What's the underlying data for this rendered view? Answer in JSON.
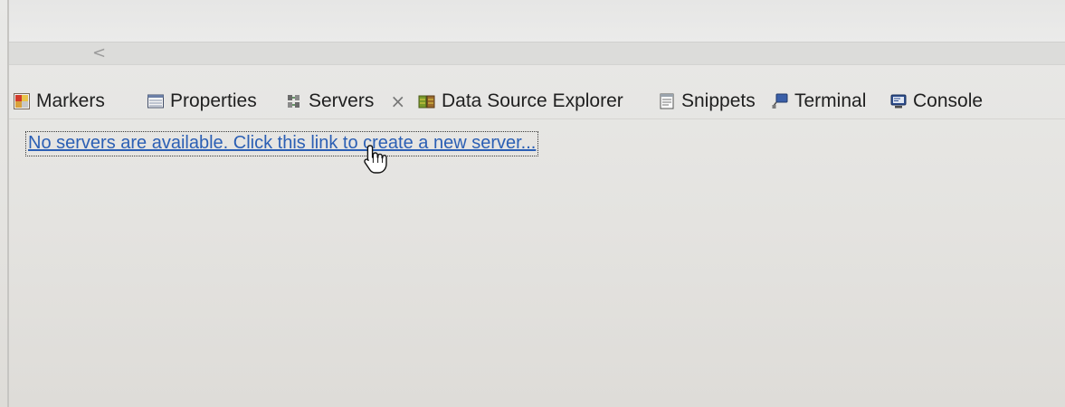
{
  "scrollbar": {
    "left_arrow": "<"
  },
  "tabs": [
    {
      "label": "Markers",
      "icon": "markers-icon"
    },
    {
      "label": "Properties",
      "icon": "properties-icon"
    },
    {
      "label": "Servers",
      "icon": "servers-icon",
      "active": true,
      "close": "×"
    },
    {
      "label": "Data Source Explorer",
      "icon": "data-source-explorer-icon"
    },
    {
      "label": "Snippets",
      "icon": "snippets-icon"
    },
    {
      "label": "Terminal",
      "icon": "terminal-icon"
    },
    {
      "label": "Console",
      "icon": "console-icon"
    }
  ],
  "servers_view": {
    "empty_link": "No servers are available. Click this link to create a new server..."
  },
  "cursor": {
    "icon": "hand-pointer-icon"
  },
  "colors": {
    "link": "#2b5fb4",
    "tab_text": "#1f1f1f",
    "background": "#e4e3e0"
  }
}
